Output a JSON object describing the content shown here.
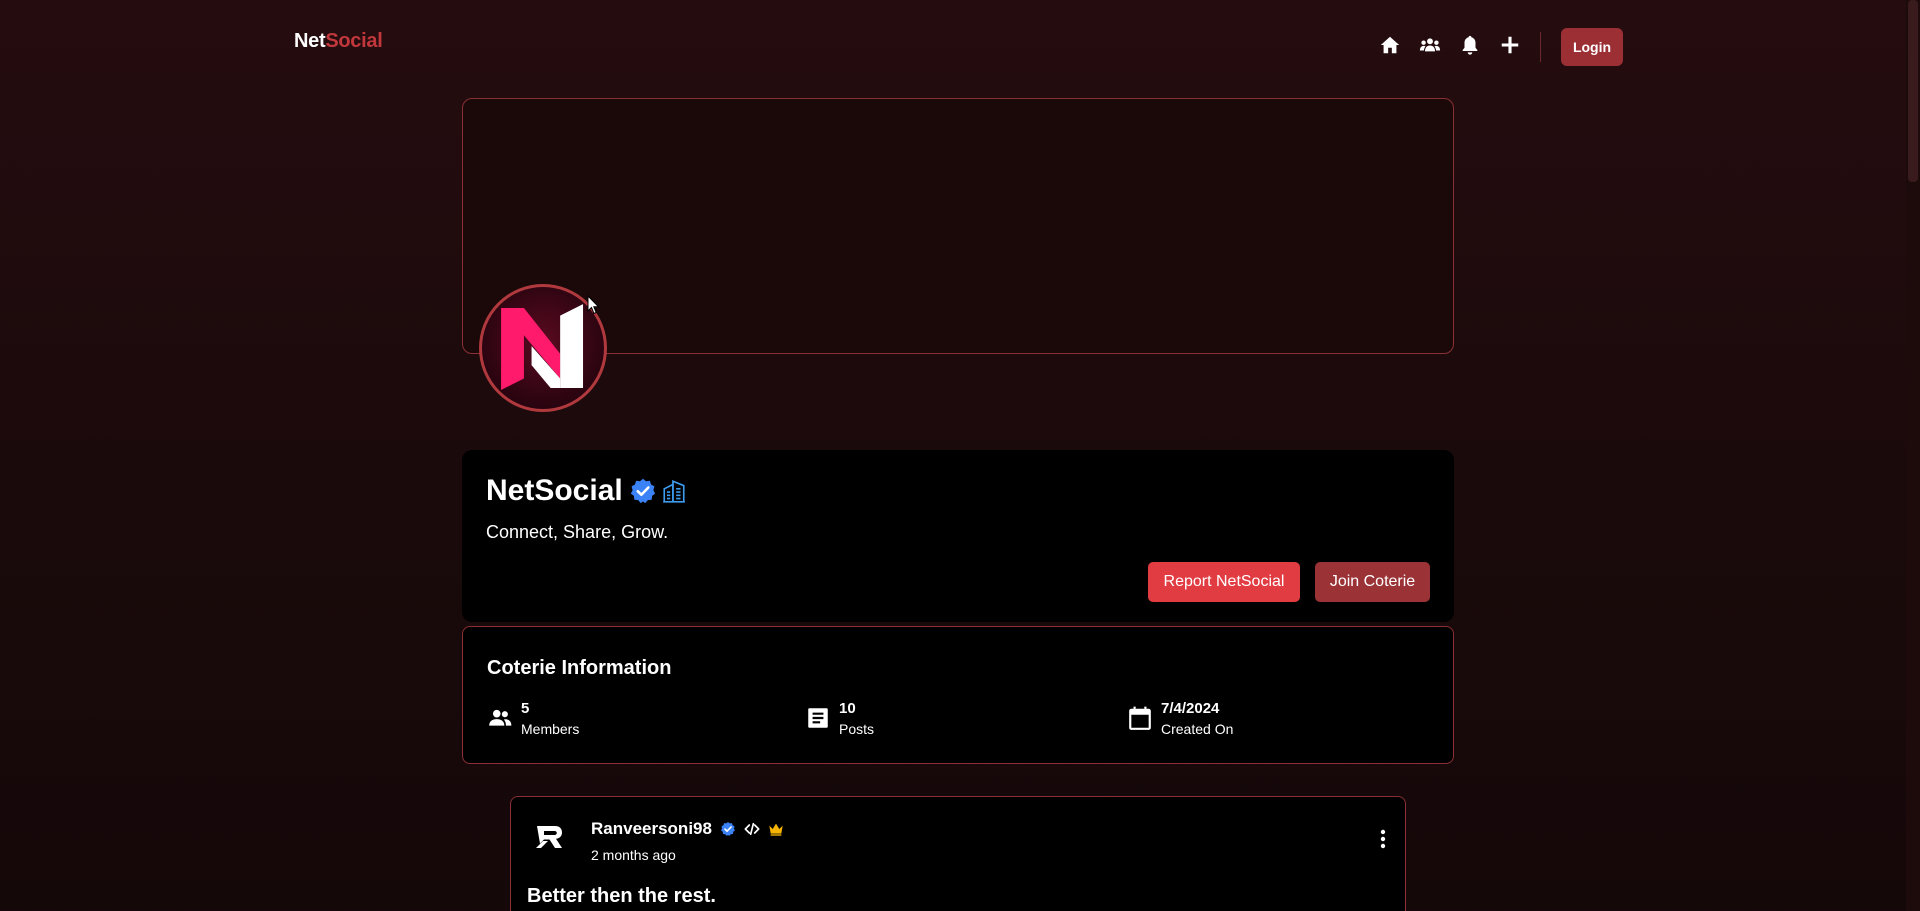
{
  "navbar": {
    "brand_part1": "Net",
    "brand_part2": "Social",
    "icons": [
      "home-icon",
      "group-icon",
      "bell-icon",
      "plus-icon"
    ],
    "login_label": "Login"
  },
  "coterie": {
    "name": "NetSocial",
    "tagline": "Connect, Share, Grow.",
    "report_label": "Report NetSocial",
    "join_label": "Join Coterie"
  },
  "info": {
    "title": "Coterie Information",
    "members_value": "5",
    "members_label": "Members",
    "posts_value": "10",
    "posts_label": "Posts",
    "created_value": "7/4/2024",
    "created_label": "Created On"
  },
  "post": {
    "username": "Ranveersoni98",
    "time": "2 months ago",
    "title": "Better then the rest."
  },
  "colors": {
    "accent": "#9b2f34",
    "report": "#e23c43",
    "brand_red": "#c1373c",
    "border": "#8a2f33"
  }
}
